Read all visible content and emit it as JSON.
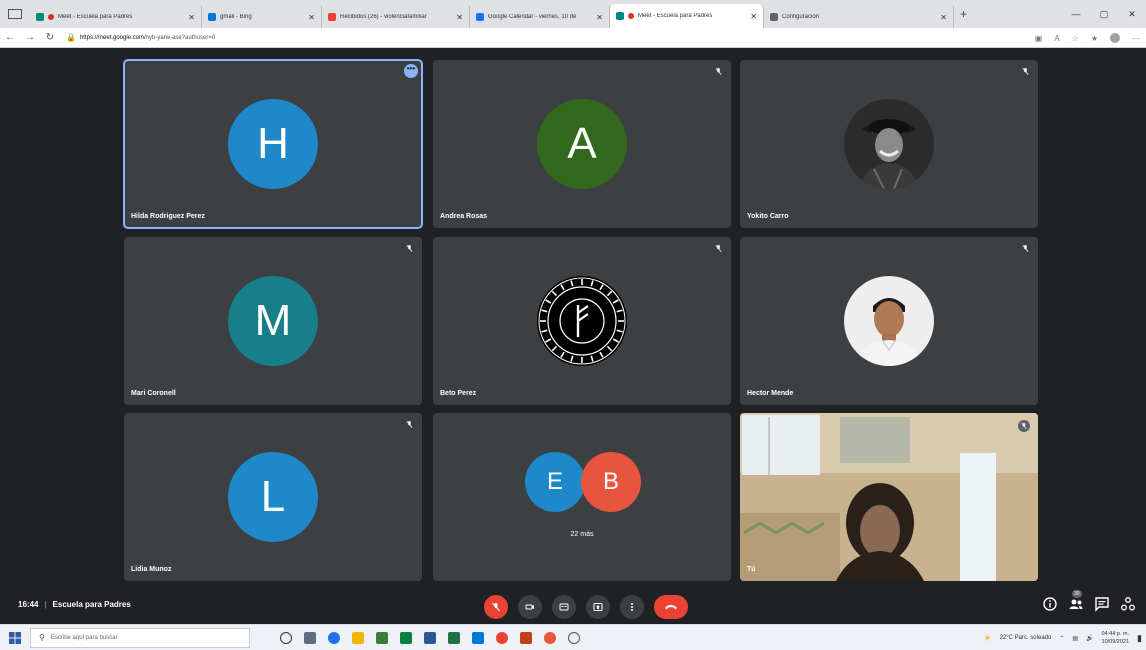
{
  "browser": {
    "tabs": [
      {
        "label": "Meet - Escuela para Padres",
        "fav": "#00897b",
        "rec": true,
        "active": false
      },
      {
        "label": "gmail - Bing",
        "fav": "#0078d4",
        "rec": false,
        "active": false
      },
      {
        "label": "Recibidos (26) - violenciafamiliar",
        "fav": "#ea4335",
        "rec": false,
        "active": false
      },
      {
        "label": "Google Calendar - viernes, 10 de",
        "fav": "#1a73e8",
        "rec": false,
        "active": false
      },
      {
        "label": "Meet - Escuela para Padres",
        "fav": "#00897b",
        "rec": true,
        "active": true
      },
      {
        "label": "Configuración",
        "fav": "#5f6368",
        "rec": false,
        "active": false
      }
    ],
    "url_host": "https://meet.google.com/",
    "url_path": "nyb-yarw-ase?authuser=0"
  },
  "participants": [
    {
      "name": "Hilda Rodriguez Perez",
      "initial": "H",
      "color": "#1e88c8",
      "kind": "initial",
      "selected": true
    },
    {
      "name": "Andrea Rosas",
      "initial": "A",
      "color": "#33691e",
      "kind": "initial",
      "selected": false
    },
    {
      "name": "Yokito Carro",
      "initial": "",
      "color": "",
      "kind": "photo-man-hat",
      "selected": false
    },
    {
      "name": "Mari Coronell",
      "initial": "M",
      "color": "#167f8a",
      "kind": "initial",
      "selected": false
    },
    {
      "name": "Beto Perez",
      "initial": "",
      "color": "",
      "kind": "rune",
      "selected": false
    },
    {
      "name": "Hector Mende",
      "initial": "",
      "color": "",
      "kind": "photo-man",
      "selected": false
    },
    {
      "name": "Lidia Munoz",
      "initial": "L",
      "color": "#1e88c8",
      "kind": "initial",
      "selected": false
    }
  ],
  "others": {
    "initial1": "E",
    "color1": "#1e88c8",
    "initial2": "B",
    "color2": "#e8553e",
    "label": "22 más"
  },
  "self": {
    "name": "Tú"
  },
  "meeting": {
    "time": "16:44",
    "title": "Escuela para Padres",
    "people_count": "30"
  },
  "taskbar": {
    "search_placeholder": "Escribe aquí para buscar",
    "weather": "22°C Parc. soleado",
    "time": "04:44 p. m.",
    "date": "10/09/2021"
  }
}
